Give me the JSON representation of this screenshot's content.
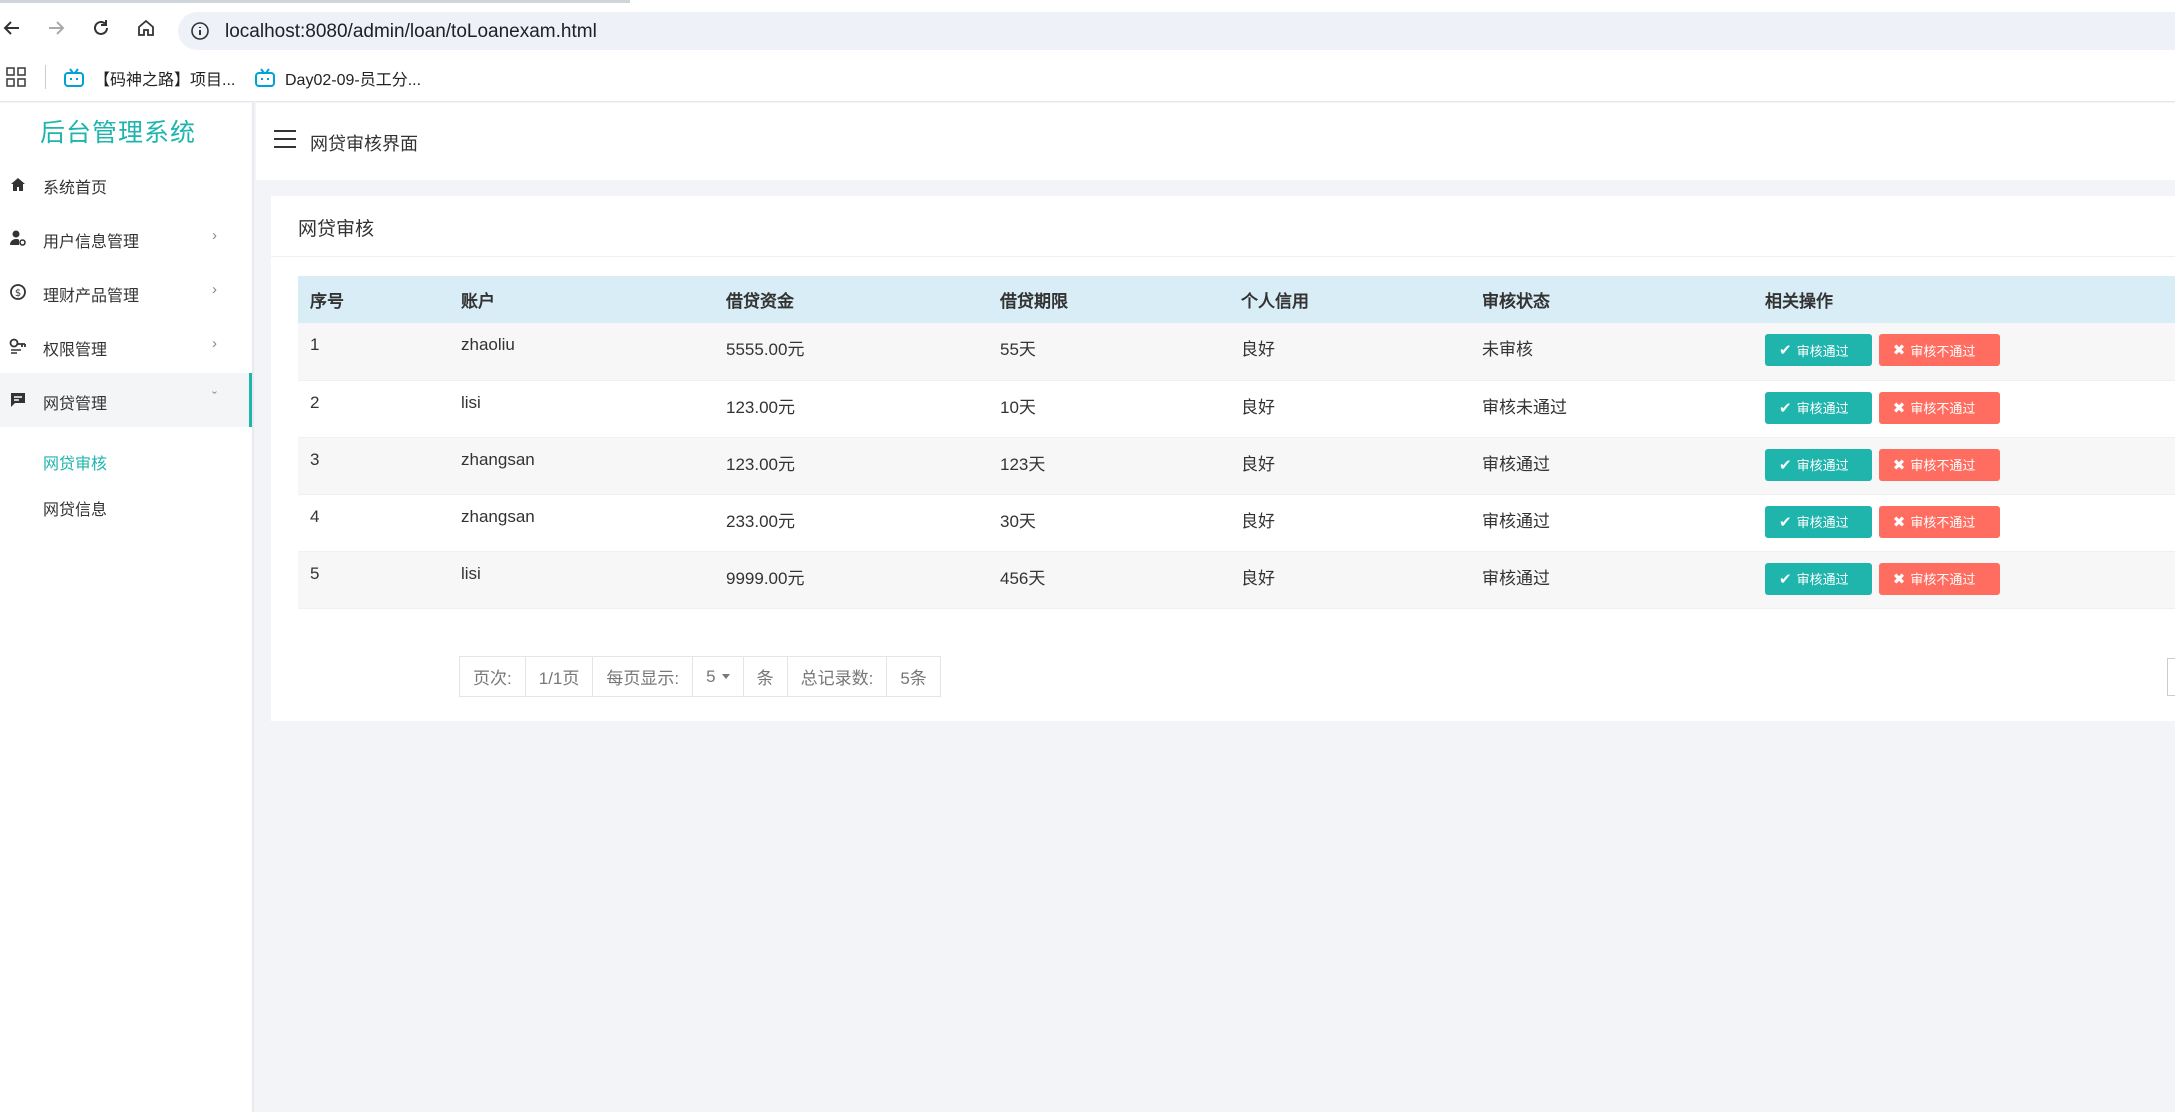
{
  "browser": {
    "url": "localhost:8080/admin/loan/toLoanexam.html",
    "bookmarks": [
      "【码神之路】项目...",
      "Day02-09-员工分..."
    ]
  },
  "sidebar": {
    "logo": "后台管理系统",
    "items": [
      {
        "label": "系统首页",
        "icon": "home-icon"
      },
      {
        "label": "用户信息管理",
        "icon": "user-settings-icon",
        "chevron": "›"
      },
      {
        "label": "理财产品管理",
        "icon": "coin-icon",
        "chevron": "›"
      },
      {
        "label": "权限管理",
        "icon": "key-icon",
        "chevron": "›"
      },
      {
        "label": "网贷管理",
        "icon": "message-icon",
        "chevron": "ˇ"
      }
    ],
    "subitems": [
      {
        "label": "网贷审核",
        "active": true
      },
      {
        "label": "网贷信息",
        "active": false
      }
    ]
  },
  "header": {
    "title": "网贷审核界面"
  },
  "panel": {
    "title": "网贷审核"
  },
  "table": {
    "columns": [
      "序号",
      "账户",
      "借贷资金",
      "借贷期限",
      "个人信用",
      "审核状态",
      "相关操作"
    ],
    "rows": [
      [
        "1",
        "zhaoliu",
        "5555.00元",
        "55天",
        "良好",
        "未审核"
      ],
      [
        "2",
        "lisi",
        "123.00元",
        "10天",
        "良好",
        "审核未通过"
      ],
      [
        "3",
        "zhangsan",
        "123.00元",
        "123天",
        "良好",
        "审核通过"
      ],
      [
        "4",
        "zhangsan",
        "233.00元",
        "30天",
        "良好",
        "审核通过"
      ],
      [
        "5",
        "lisi",
        "9999.00元",
        "456天",
        "良好",
        "审核通过"
      ]
    ],
    "approve_label": "审核通过",
    "reject_label": "审核不通过"
  },
  "pager": {
    "page_label": "页次:",
    "page_value": "1/1页",
    "per_page_label": "每页显示:",
    "per_page_value": "5",
    "per_page_unit": "条",
    "total_label": "总记录数:",
    "total_value": "5条"
  },
  "colors": {
    "accent": "#1fb5ad",
    "danger": "#ff6c60",
    "table_header": "#d9edf6"
  }
}
